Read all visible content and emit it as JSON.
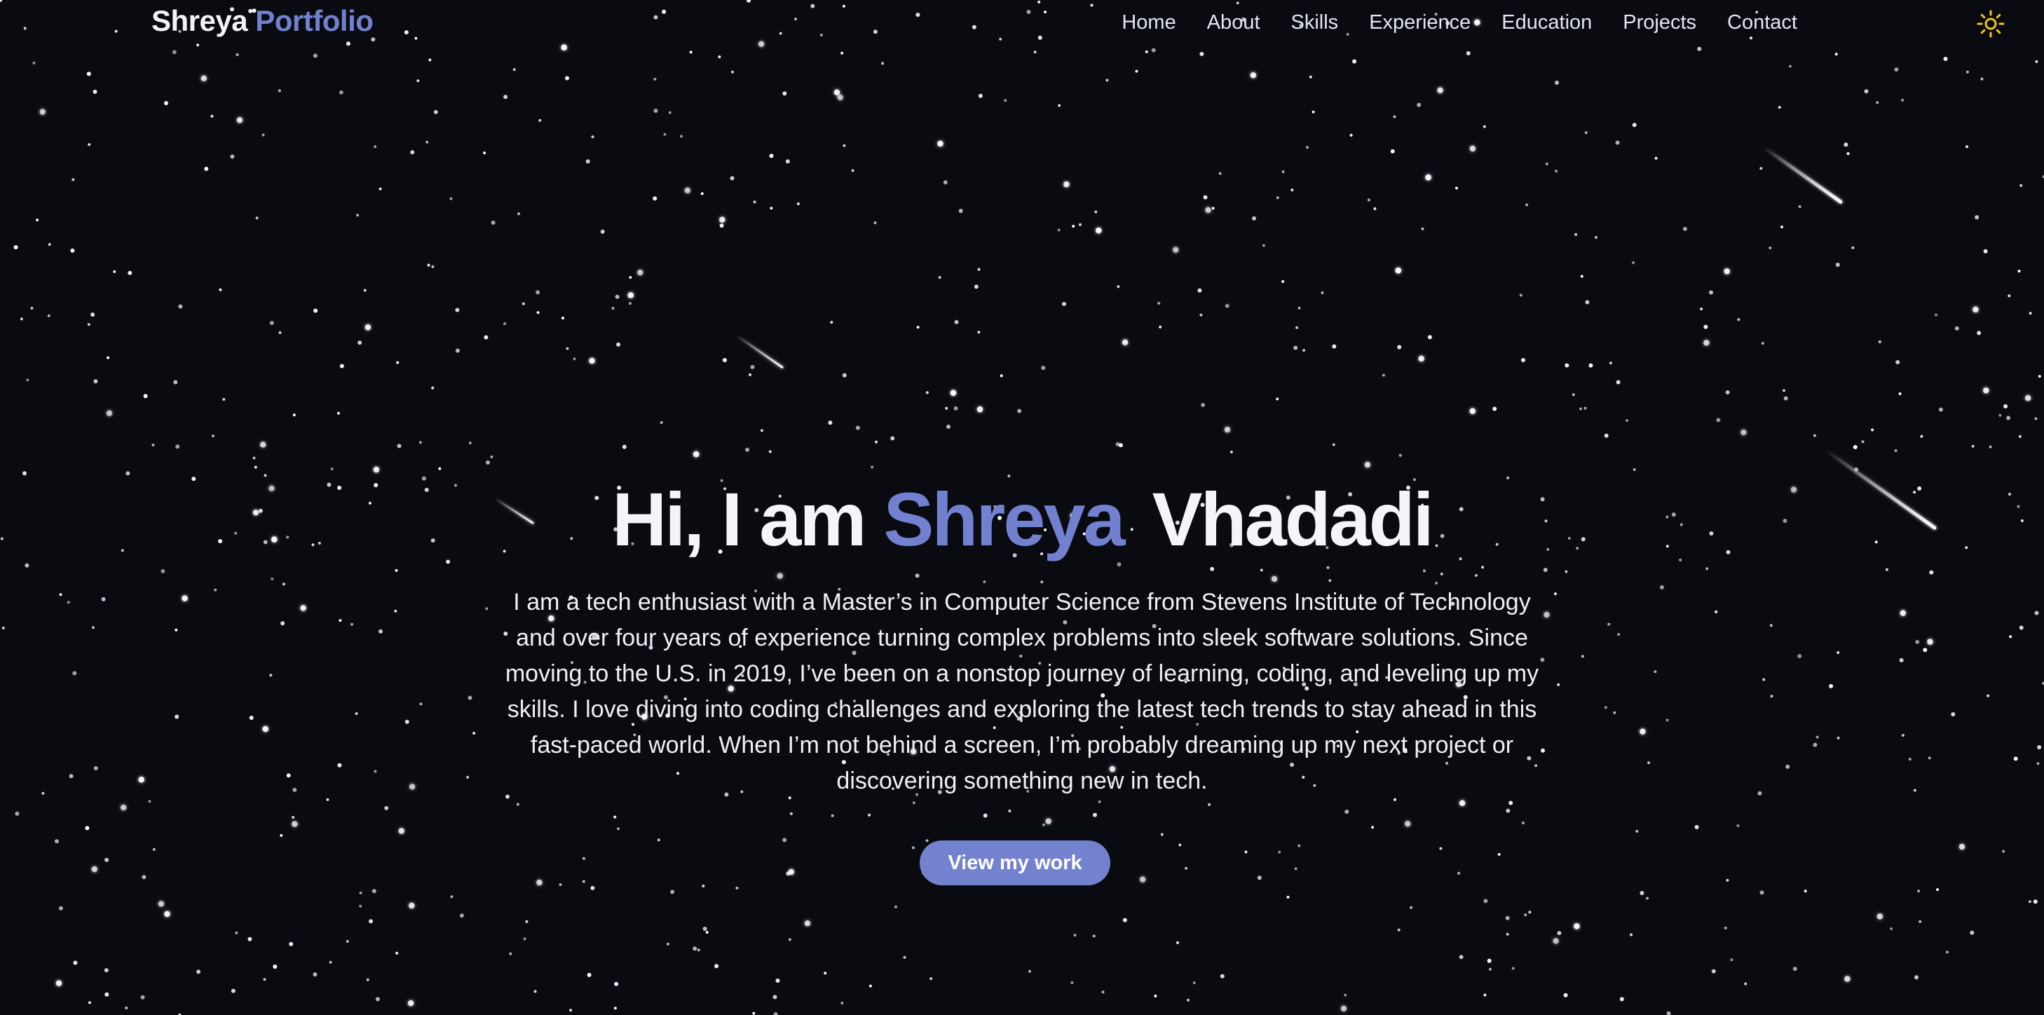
{
  "nav": {
    "logo_first": "Shreya",
    "logo_accent": "Portfolio",
    "links": [
      "Home",
      "About",
      "Skills",
      "Experience",
      "Education",
      "Projects",
      "Contact"
    ],
    "theme_icon": "sun-icon"
  },
  "hero": {
    "greeting": "Hi, I am",
    "first_name": "Shreya",
    "last_name": "Vhadadi",
    "bio": "I am a tech enthusiast with a Master’s in Computer Science from Stevens Institute of Technology and over four years of experience turning complex problems into sleek software solutions. Since moving to the U.S. in 2019, I’ve been on a nonstop journey of learning, coding, and leveling up my skills. I love diving into coding challenges and exploring the latest tech trends to stay ahead in this fast-paced world. When I’m not behind a screen, I’m probably dreaming up my next project or discovering something new in tech.",
    "cta_label": "View my work"
  },
  "colors": {
    "background": "#090b11",
    "accent": "#7281cf",
    "text": "#eef0f5",
    "sun": "#f5c518"
  }
}
